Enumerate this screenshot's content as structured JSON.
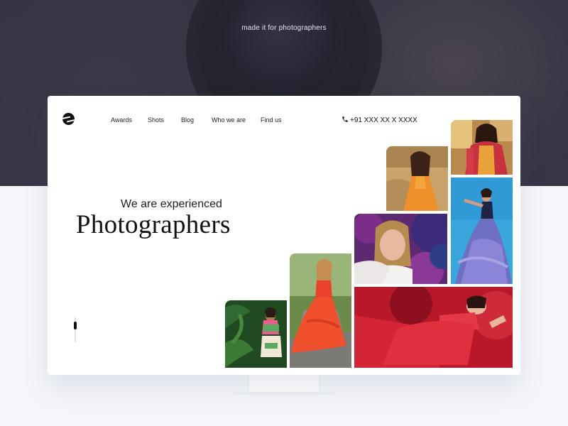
{
  "tagline": "made it for photographers",
  "nav": {
    "items": [
      {
        "label": "Awards"
      },
      {
        "label": "Shots"
      },
      {
        "label": "Blog"
      },
      {
        "label": "Who we are"
      },
      {
        "label": "Find us"
      }
    ],
    "phone": "+91 XXX XX X XXXX"
  },
  "hero": {
    "subtitle": "We are experienced",
    "title": "Photographers"
  },
  "icons": {
    "logo": "brand-logo-icon",
    "phone": "phone-icon"
  },
  "gallery": [
    {
      "name": "woman-in-bridal-saree",
      "dominant_color": "#c83c48"
    },
    {
      "name": "woman-in-orange-dress-field",
      "dominant_color": "#e58a1c"
    },
    {
      "name": "woman-in-blue-ballgown",
      "dominant_color": "#5a6fb0"
    },
    {
      "name": "woman-in-purple-foliage",
      "dominant_color": "#6b2f7e"
    },
    {
      "name": "woman-in-red-dress-walking",
      "dominant_color": "#e2442a"
    },
    {
      "name": "woman-in-red-gown-lying",
      "dominant_color": "#c4202e"
    },
    {
      "name": "woman-in-green-jungle",
      "dominant_color": "#2f5a2a"
    }
  ],
  "colors": {
    "backdrop": "#3b3a49",
    "card": "#ffffff",
    "page": "#f4f6fa",
    "text": "#111111"
  }
}
